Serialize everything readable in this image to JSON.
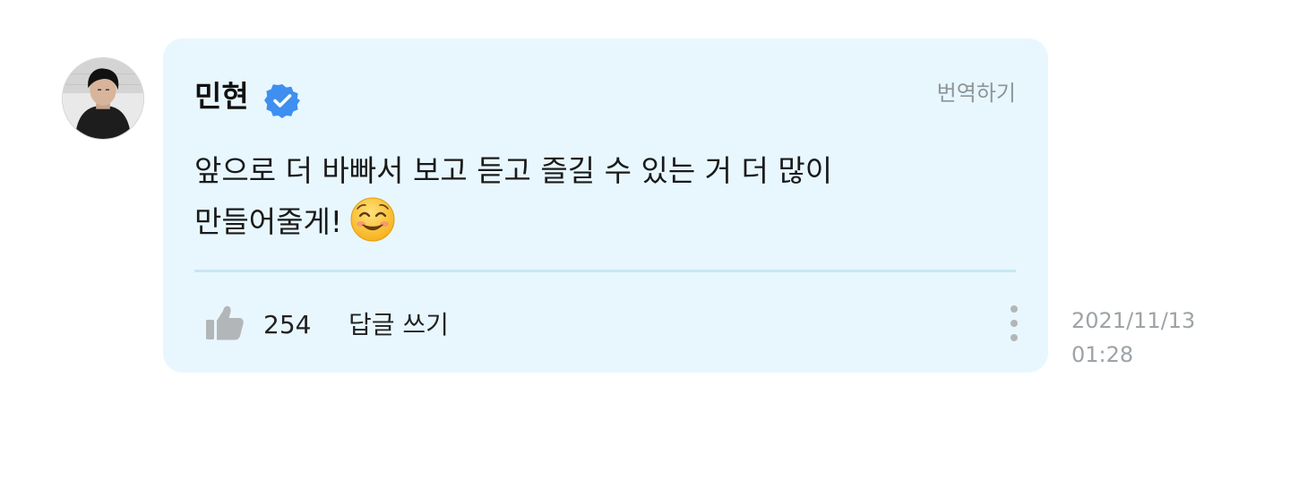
{
  "comment": {
    "author": "민현",
    "translate_label": "번역하기",
    "message_line1": "앞으로 더 바빠서 보고 듣고 즐길 수 있는 거 더 많이",
    "message_line2": "만들어줄게!",
    "emoji": "smiling-face-with-smiling-eyes",
    "like_count": "254",
    "reply_label": "답글 쓰기",
    "date": "2021/11/13",
    "time": "01:28"
  },
  "colors": {
    "bubble_bg": "#e8f7fe",
    "verified_badge": "#3f8ff0",
    "divider": "#c7e6f2",
    "icon_gray": "#b3b6b9",
    "muted_text": "#9da3a7"
  }
}
